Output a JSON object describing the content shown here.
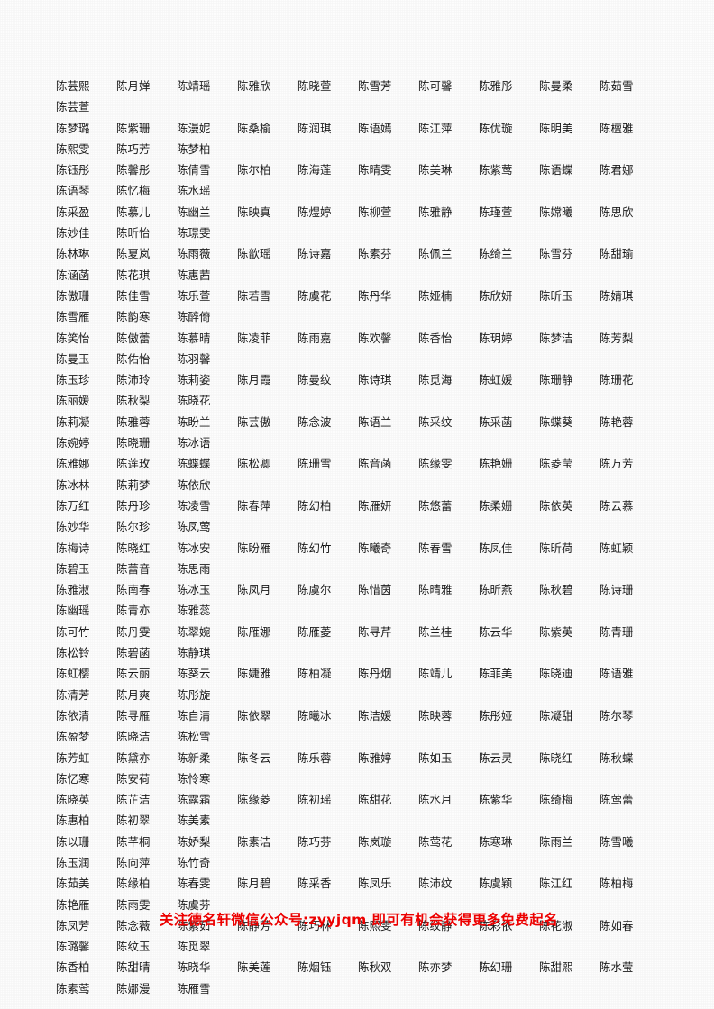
{
  "document": {
    "type": "name-list-sheet",
    "surname": "陈",
    "columns_per_row": 10,
    "text_color": "#1a1a1a",
    "background_color": "#fdfdfd"
  },
  "rows": [
    [
      "陈芸熙",
      "陈月婵",
      "陈靖瑶",
      "陈雅欣",
      "陈晓萱",
      "陈雪芳",
      "陈可馨",
      "陈雅彤",
      "陈曼柔",
      "陈茹雪",
      "陈芸萱"
    ],
    [
      "陈梦璐",
      "陈紫珊",
      "陈漫妮",
      "陈桑榆",
      "陈润琪",
      "陈语嫣",
      "陈江萍",
      "陈优璇",
      "陈明美",
      "陈檀雅",
      "陈熙雯",
      "陈巧芳",
      "陈梦柏"
    ],
    [
      "陈钰彤",
      "陈馨彤",
      "陈倩雪",
      "陈尔柏",
      "陈海莲",
      "陈晴雯",
      "陈美琳",
      "陈紫莺",
      "陈语蝶",
      "陈君娜",
      "陈语琴",
      "陈忆梅",
      "陈水瑶"
    ],
    [
      "陈采盈",
      "陈慕儿",
      "陈幽兰",
      "陈映真",
      "陈煜婷",
      "陈柳萱",
      "陈雅静",
      "陈瑾萱",
      "陈嫦曦",
      "陈思欣",
      "陈妙佳",
      "陈昕怡",
      "陈璟雯"
    ],
    [
      "陈林琳",
      "陈夏岚",
      "陈雨薇",
      "陈歆瑶",
      "陈诗嘉",
      "陈素芬",
      "陈佩兰",
      "陈绮兰",
      "陈雪芬",
      "陈甜瑜",
      "陈涵菡",
      "陈花琪",
      "陈惠茜"
    ],
    [
      "陈傲珊",
      "陈佳雪",
      "陈乐萱",
      "陈若雪",
      "陈虞花",
      "陈丹华",
      "陈娅楠",
      "陈欣妍",
      "陈昕玉",
      "陈婧琪",
      "陈雪雁",
      "陈韵寒",
      "陈醉倚"
    ],
    [
      "陈笑怡",
      "陈傲蕾",
      "陈慕晴",
      "陈凌菲",
      "陈雨嘉",
      "陈欢馨",
      "陈香怡",
      "陈玥婷",
      "陈梦洁",
      "陈芳梨",
      "陈曼玉",
      "陈佑怡",
      "陈羽馨"
    ],
    [
      "陈玉珍",
      "陈沛玲",
      "陈莉姿",
      "陈月霞",
      "陈曼纹",
      "陈诗琪",
      "陈觅海",
      "陈虹媛",
      "陈珊静",
      "陈珊花",
      "陈丽媛",
      "陈秋梨",
      "陈晓花"
    ],
    [
      "陈莉凝",
      "陈雅蓉",
      "陈盼兰",
      "陈芸傲",
      "陈念波",
      "陈语兰",
      "陈采纹",
      "陈采菡",
      "陈蝶葵",
      "陈艳蓉",
      "陈婉婷",
      "陈晓珊",
      "陈冰语"
    ],
    [
      "陈雅娜",
      "陈莲玫",
      "陈蝶蝶",
      "陈松卿",
      "陈珊雪",
      "陈音菡",
      "陈缘雯",
      "陈艳姗",
      "陈菱莹",
      "陈万芳",
      "陈冰林",
      "陈莉梦",
      "陈依欣"
    ],
    [
      "陈万红",
      "陈丹珍",
      "陈凌雪",
      "陈春萍",
      "陈幻柏",
      "陈雁妍",
      "陈悠蕾",
      "陈柔姗",
      "陈依英",
      "陈云慕",
      "陈妙华",
      "陈尔珍",
      "陈凤莺"
    ],
    [
      "陈梅诗",
      "陈晓红",
      "陈冰安",
      "陈盼雁",
      "陈幻竹",
      "陈曦奇",
      "陈春雪",
      "陈凤佳",
      "陈昕荷",
      "陈虹颖",
      "陈碧玉",
      "陈蕾音",
      "陈思雨"
    ],
    [
      "陈雅淑",
      "陈南春",
      "陈冰玉",
      "陈凤月",
      "陈虞尔",
      "陈惜茵",
      "陈晴雅",
      "陈昕燕",
      "陈秋碧",
      "陈诗珊",
      "陈幽瑶",
      "陈青亦",
      "陈雅蕊"
    ],
    [
      "陈可竹",
      "陈丹雯",
      "陈翠婉",
      "陈雁娜",
      "陈雁菱",
      "陈寻芹",
      "陈兰桂",
      "陈云华",
      "陈紫英",
      "陈青珊",
      "陈松铃",
      "陈碧菡",
      "陈静琪"
    ],
    [
      "陈虹樱",
      "陈云丽",
      "陈葵云",
      "陈婕雅",
      "陈柏凝",
      "陈丹烟",
      "陈靖儿",
      "陈菲美",
      "陈晓迪",
      "陈语雅",
      "陈清芳",
      "陈月爽",
      "陈彤旋"
    ],
    [
      "陈依清",
      "陈寻雁",
      "陈自清",
      "陈依翠",
      "陈曦冰",
      "陈洁媛",
      "陈映蓉",
      "陈彤娅",
      "陈凝甜",
      "陈尔琴",
      "陈盈梦",
      "陈晓洁",
      "陈松雪"
    ],
    [
      "陈芳虹",
      "陈黛亦",
      "陈新柔",
      "陈冬云",
      "陈乐蓉",
      "陈雅婷",
      "陈如玉",
      "陈云灵",
      "陈晓红",
      "陈秋蝶",
      "陈忆寒",
      "陈安荷",
      "陈怜寒"
    ],
    [
      "陈晓英",
      "陈芷洁",
      "陈露霜",
      "陈缘菱",
      "陈初瑶",
      "陈甜花",
      "陈水月",
      "陈紫华",
      "陈绮梅",
      "陈莺蕾",
      "陈惠柏",
      "陈初翠",
      "陈美素"
    ],
    [
      "陈以珊",
      "陈芊桐",
      "陈娇梨",
      "陈素洁",
      "陈巧芬",
      "陈岚璇",
      "陈莺花",
      "陈寒琳",
      "陈雨兰",
      "陈雪曦",
      "陈玉润",
      "陈向萍",
      "陈竹奇"
    ],
    [
      "陈茹美",
      "陈缘柏",
      "陈春雯",
      "陈月碧",
      "陈采香",
      "陈凤乐",
      "陈沛纹",
      "陈虞颖",
      "陈江红",
      "陈柏梅",
      "陈艳雁",
      "陈雨雯",
      "陈虞芬"
    ],
    [
      "陈凤芳",
      "陈念薇",
      "陈紫茹",
      "陈静芳",
      "陈巧林",
      "陈熙雯",
      "陈纹静",
      "陈彩依",
      "陈花淑",
      "陈如春",
      "陈璐馨",
      "陈纹玉",
      "陈觅翠"
    ],
    [
      "陈香柏",
      "陈甜晴",
      "陈晓华",
      "陈美莲",
      "陈烟钰",
      "陈秋双",
      "陈亦梦",
      "陈幻珊",
      "陈甜熙",
      "陈水莹",
      "陈素莺",
      "陈娜漫",
      "陈雁雪"
    ]
  ],
  "footer": {
    "promo_text": "关注德名轩微信公众号:zyyjqm  即可有机会获得更多免费起名",
    "color": "#f10000"
  }
}
